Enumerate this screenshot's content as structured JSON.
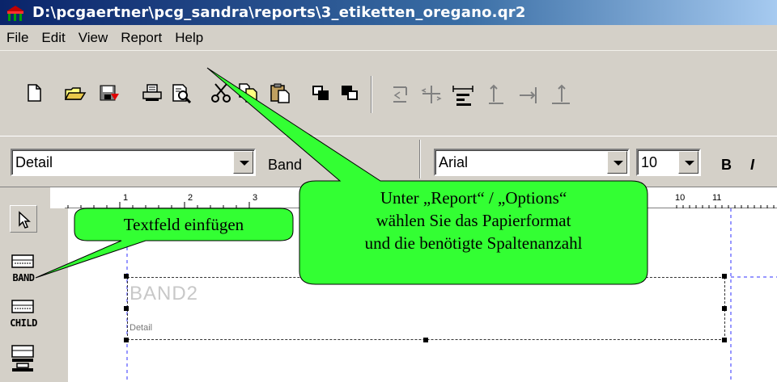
{
  "window": {
    "title": "D:\\pcgaertner\\pcg_sandra\\reports\\3_etiketten_oregano.qr2"
  },
  "menu": [
    "File",
    "Edit",
    "View",
    "Report",
    "Help"
  ],
  "toolbar": {
    "buttons": [
      "new-icon",
      "open-icon",
      "save-icon",
      "print-icon",
      "preview-icon",
      "cut-icon",
      "copy-icon",
      "paste-icon",
      "bring-to-front-icon",
      "send-to-back-icon",
      "align-left-icon",
      "align-center-icon",
      "align-width-icon",
      "align-top-icon",
      "align-right-icon",
      "align-bottom-icon"
    ]
  },
  "format": {
    "band_select": "Detail",
    "band_label": "Band",
    "font_select": "Arial",
    "size_select": "10",
    "bold_label": "B",
    "italic_label": "I"
  },
  "palette": {
    "items": [
      {
        "icon": "pointer-icon",
        "label": ""
      },
      {
        "icon": "band-icon",
        "label": "BAND"
      },
      {
        "icon": "child-icon",
        "label": "CHILD"
      },
      {
        "icon": "subdetail-icon",
        "label": ""
      }
    ]
  },
  "ruler": {
    "marks": [
      "1",
      "2",
      "3",
      "10",
      "11"
    ]
  },
  "band": {
    "name": "BAND2",
    "type": "Detail"
  },
  "callouts": {
    "left": "Textfeld einfügen",
    "right": [
      "Unter „Report“ / „Options“",
      "wählen Sie das Papierformat",
      "und die benötigte Spaltenanzahl"
    ]
  },
  "colors": {
    "callout_fill": "#33ff33",
    "callout_border": "#000000",
    "titlebar": "#0a246a"
  }
}
